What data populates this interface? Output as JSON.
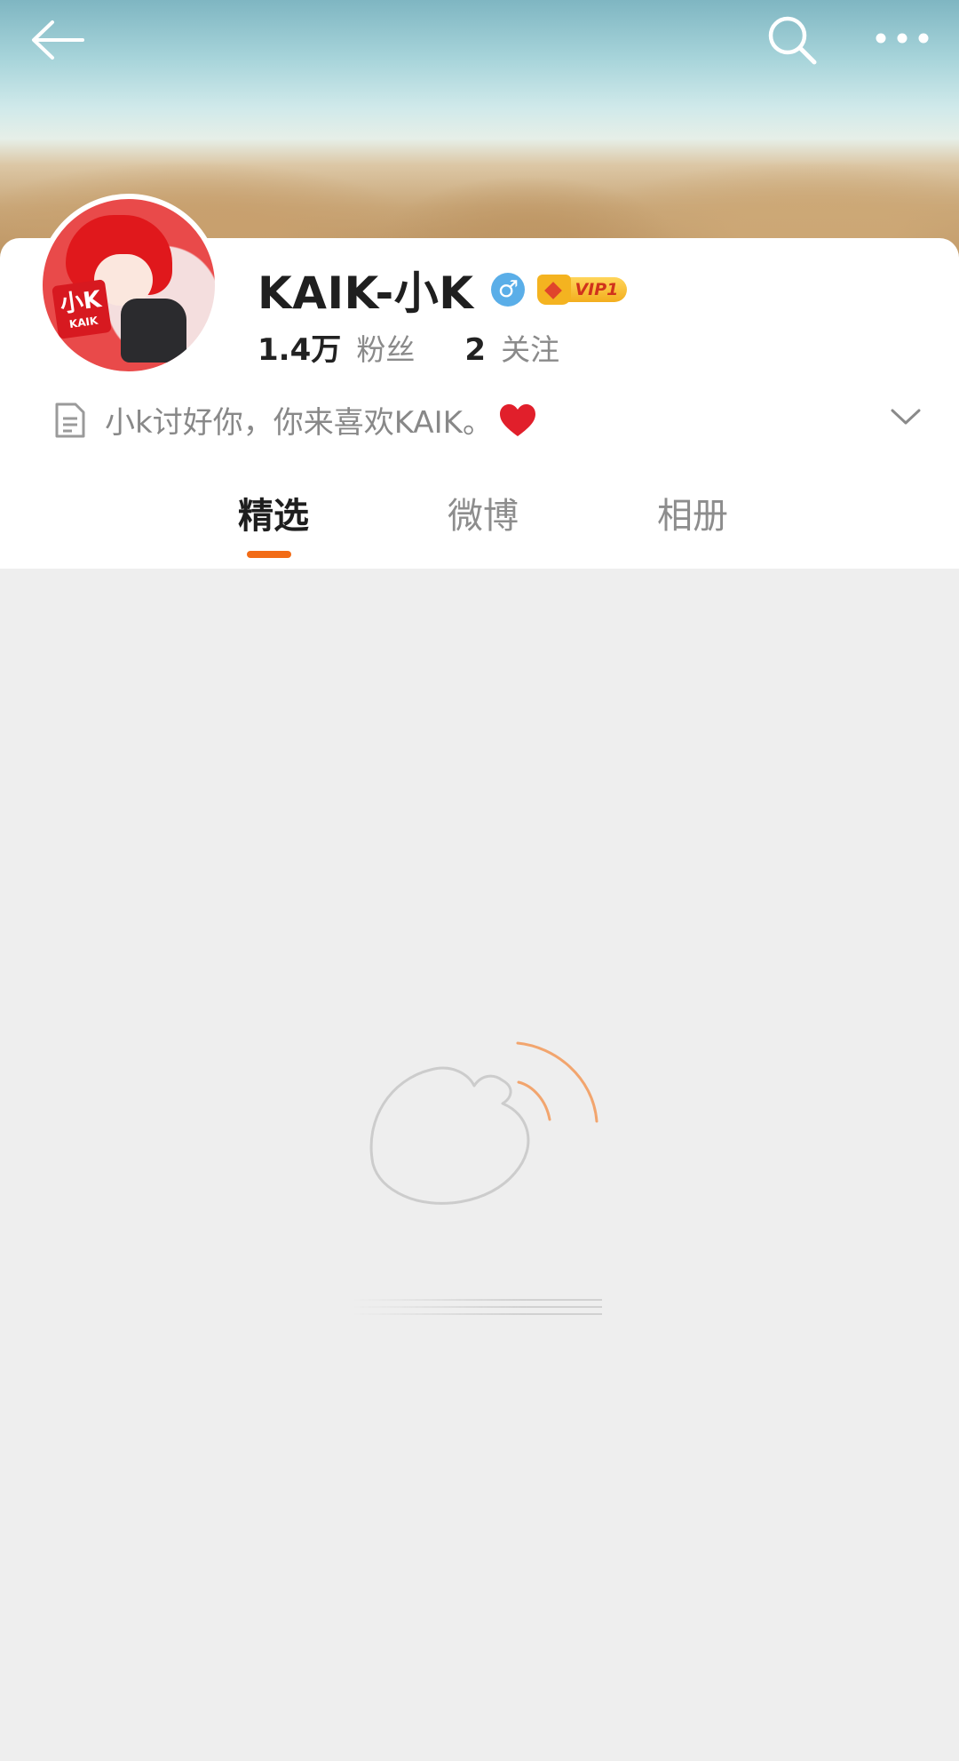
{
  "profile": {
    "name": "KAIK-小K",
    "gender_symbol": "♂",
    "vip_label": "VIP1",
    "avatar_text_large": "小K",
    "avatar_text_small": "KAIK",
    "followers_count": "1.4万",
    "followers_label": "粉丝",
    "following_count": "2",
    "following_label": "关注",
    "bio": "小k讨好你，你来喜欢KAIK。"
  },
  "tabs": [
    {
      "label": "精选",
      "active": true
    },
    {
      "label": "微博",
      "active": false
    },
    {
      "label": "相册",
      "active": false
    }
  ],
  "colors": {
    "accent": "#f26b16",
    "gender_badge": "#5aaee8",
    "vip_gold": "#f3ae1e",
    "background": "#eeeeee"
  },
  "icons": {
    "back": "arrow-left-icon",
    "search": "search-icon",
    "more": "more-dots-icon",
    "bio": "document-icon",
    "heart": "heart-icon",
    "expand": "chevron-down-icon",
    "loading": "weibo-logo-loading-icon"
  }
}
